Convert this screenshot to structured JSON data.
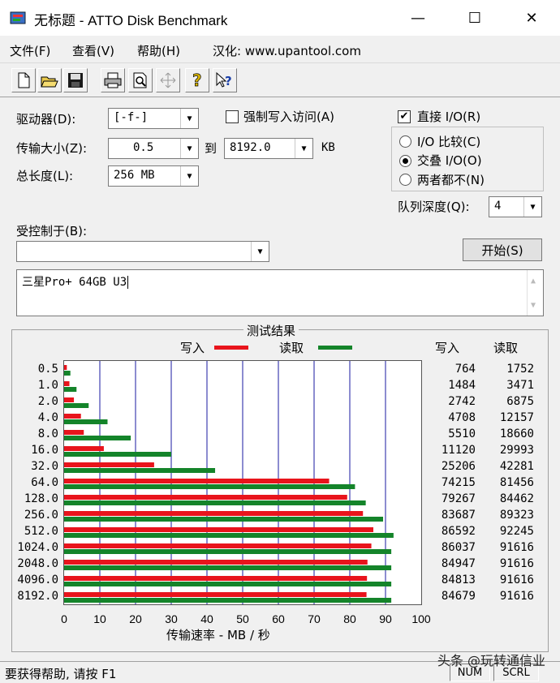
{
  "window": {
    "title": "无标题 - ATTO Disk Benchmark",
    "minimize": "—",
    "maximize": "☐",
    "close": "✕"
  },
  "menu": {
    "file": "文件(F)",
    "view": "查看(V)",
    "help": "帮助(H)",
    "localization": "汉化: www.upantool.com"
  },
  "toolbar": {
    "icons": [
      "new-icon",
      "open-icon",
      "save-icon",
      "print-icon",
      "print-preview-icon",
      "move-icon",
      "help-icon",
      "context-help-icon"
    ]
  },
  "settings": {
    "drive_label": "驱动器(D):",
    "drive_value": "[-f-]",
    "transfer_label": "传输大小(Z):",
    "transfer_from": "0.5",
    "transfer_to_label": "到",
    "transfer_to": "8192.0",
    "transfer_unit": "KB",
    "length_label": "总长度(L):",
    "length_value": "256 MB",
    "force_write_label": "强制写入访问(A)",
    "force_write_checked": false,
    "direct_io_label": "直接 I/O(R)",
    "direct_io_checked": true,
    "io_compare": "I/O 比较(C)",
    "overlapped_io": "交叠 I/O(O)",
    "neither": "两者都不(N)",
    "selected_radio": "overlapped_io",
    "queue_label": "队列深度(Q):",
    "queue_value": "4",
    "controlled_by_label": "受控制于(B):",
    "controlled_by_value": "",
    "start_button": "开始(S)",
    "description": "三星Pro+ 64GB U3"
  },
  "results": {
    "title": "测试结果",
    "legend_write": "写入",
    "legend_read": "读取",
    "col_write": "写入",
    "col_read": "读取",
    "write_color": "#e8141c",
    "read_color": "#14842a",
    "grid_color": "#1a1aa0"
  },
  "chart_data": {
    "type": "bar",
    "orientation": "horizontal",
    "categories": [
      "0.5",
      "1.0",
      "2.0",
      "4.0",
      "8.0",
      "16.0",
      "32.0",
      "64.0",
      "128.0",
      "256.0",
      "512.0",
      "1024.0",
      "2048.0",
      "4096.0",
      "8192.0"
    ],
    "series": [
      {
        "name": "写入",
        "values": [
          764,
          1484,
          2742,
          4708,
          5510,
          11120,
          25206,
          74215,
          79267,
          83687,
          86592,
          86037,
          84947,
          84813,
          84679
        ]
      },
      {
        "name": "读取",
        "values": [
          1752,
          3471,
          6875,
          12157,
          18660,
          29993,
          42281,
          81456,
          84462,
          89323,
          92245,
          91616,
          91616,
          91616,
          91616
        ]
      }
    ],
    "xlabel": "传输速率 - MB / 秒",
    "xticks": [
      "0",
      "10",
      "20",
      "30",
      "40",
      "50",
      "60",
      "70",
      "80",
      "90",
      "100"
    ],
    "xlim": [
      0,
      100
    ],
    "value_unit_divisor": 1000,
    "grid": true
  },
  "status": {
    "help_text": "要获得帮助, 请按 F1",
    "num": "NUM",
    "scrl": "SCRL",
    "watermark": "头条 @玩转通信业"
  }
}
